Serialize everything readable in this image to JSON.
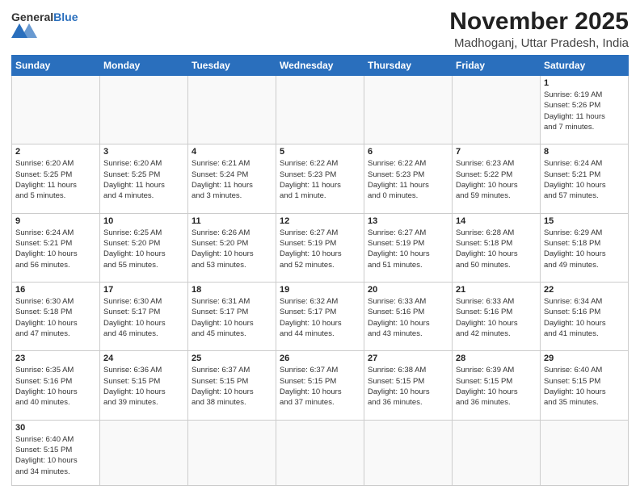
{
  "header": {
    "logo_general": "General",
    "logo_blue": "Blue",
    "month_year": "November 2025",
    "location": "Madhoganj, Uttar Pradesh, India"
  },
  "weekdays": [
    "Sunday",
    "Monday",
    "Tuesday",
    "Wednesday",
    "Thursday",
    "Friday",
    "Saturday"
  ],
  "weeks": [
    [
      {
        "day": "",
        "info": ""
      },
      {
        "day": "",
        "info": ""
      },
      {
        "day": "",
        "info": ""
      },
      {
        "day": "",
        "info": ""
      },
      {
        "day": "",
        "info": ""
      },
      {
        "day": "",
        "info": ""
      },
      {
        "day": "1",
        "info": "Sunrise: 6:19 AM\nSunset: 5:26 PM\nDaylight: 11 hours\nand 7 minutes."
      }
    ],
    [
      {
        "day": "2",
        "info": "Sunrise: 6:20 AM\nSunset: 5:25 PM\nDaylight: 11 hours\nand 5 minutes."
      },
      {
        "day": "3",
        "info": "Sunrise: 6:20 AM\nSunset: 5:25 PM\nDaylight: 11 hours\nand 4 minutes."
      },
      {
        "day": "4",
        "info": "Sunrise: 6:21 AM\nSunset: 5:24 PM\nDaylight: 11 hours\nand 3 minutes."
      },
      {
        "day": "5",
        "info": "Sunrise: 6:22 AM\nSunset: 5:23 PM\nDaylight: 11 hours\nand 1 minute."
      },
      {
        "day": "6",
        "info": "Sunrise: 6:22 AM\nSunset: 5:23 PM\nDaylight: 11 hours\nand 0 minutes."
      },
      {
        "day": "7",
        "info": "Sunrise: 6:23 AM\nSunset: 5:22 PM\nDaylight: 10 hours\nand 59 minutes."
      },
      {
        "day": "8",
        "info": "Sunrise: 6:24 AM\nSunset: 5:21 PM\nDaylight: 10 hours\nand 57 minutes."
      }
    ],
    [
      {
        "day": "9",
        "info": "Sunrise: 6:24 AM\nSunset: 5:21 PM\nDaylight: 10 hours\nand 56 minutes."
      },
      {
        "day": "10",
        "info": "Sunrise: 6:25 AM\nSunset: 5:20 PM\nDaylight: 10 hours\nand 55 minutes."
      },
      {
        "day": "11",
        "info": "Sunrise: 6:26 AM\nSunset: 5:20 PM\nDaylight: 10 hours\nand 53 minutes."
      },
      {
        "day": "12",
        "info": "Sunrise: 6:27 AM\nSunset: 5:19 PM\nDaylight: 10 hours\nand 52 minutes."
      },
      {
        "day": "13",
        "info": "Sunrise: 6:27 AM\nSunset: 5:19 PM\nDaylight: 10 hours\nand 51 minutes."
      },
      {
        "day": "14",
        "info": "Sunrise: 6:28 AM\nSunset: 5:18 PM\nDaylight: 10 hours\nand 50 minutes."
      },
      {
        "day": "15",
        "info": "Sunrise: 6:29 AM\nSunset: 5:18 PM\nDaylight: 10 hours\nand 49 minutes."
      }
    ],
    [
      {
        "day": "16",
        "info": "Sunrise: 6:30 AM\nSunset: 5:18 PM\nDaylight: 10 hours\nand 47 minutes."
      },
      {
        "day": "17",
        "info": "Sunrise: 6:30 AM\nSunset: 5:17 PM\nDaylight: 10 hours\nand 46 minutes."
      },
      {
        "day": "18",
        "info": "Sunrise: 6:31 AM\nSunset: 5:17 PM\nDaylight: 10 hours\nand 45 minutes."
      },
      {
        "day": "19",
        "info": "Sunrise: 6:32 AM\nSunset: 5:17 PM\nDaylight: 10 hours\nand 44 minutes."
      },
      {
        "day": "20",
        "info": "Sunrise: 6:33 AM\nSunset: 5:16 PM\nDaylight: 10 hours\nand 43 minutes."
      },
      {
        "day": "21",
        "info": "Sunrise: 6:33 AM\nSunset: 5:16 PM\nDaylight: 10 hours\nand 42 minutes."
      },
      {
        "day": "22",
        "info": "Sunrise: 6:34 AM\nSunset: 5:16 PM\nDaylight: 10 hours\nand 41 minutes."
      }
    ],
    [
      {
        "day": "23",
        "info": "Sunrise: 6:35 AM\nSunset: 5:16 PM\nDaylight: 10 hours\nand 40 minutes."
      },
      {
        "day": "24",
        "info": "Sunrise: 6:36 AM\nSunset: 5:15 PM\nDaylight: 10 hours\nand 39 minutes."
      },
      {
        "day": "25",
        "info": "Sunrise: 6:37 AM\nSunset: 5:15 PM\nDaylight: 10 hours\nand 38 minutes."
      },
      {
        "day": "26",
        "info": "Sunrise: 6:37 AM\nSunset: 5:15 PM\nDaylight: 10 hours\nand 37 minutes."
      },
      {
        "day": "27",
        "info": "Sunrise: 6:38 AM\nSunset: 5:15 PM\nDaylight: 10 hours\nand 36 minutes."
      },
      {
        "day": "28",
        "info": "Sunrise: 6:39 AM\nSunset: 5:15 PM\nDaylight: 10 hours\nand 36 minutes."
      },
      {
        "day": "29",
        "info": "Sunrise: 6:40 AM\nSunset: 5:15 PM\nDaylight: 10 hours\nand 35 minutes."
      }
    ],
    [
      {
        "day": "30",
        "info": "Sunrise: 6:40 AM\nSunset: 5:15 PM\nDaylight: 10 hours\nand 34 minutes."
      },
      {
        "day": "",
        "info": ""
      },
      {
        "day": "",
        "info": ""
      },
      {
        "day": "",
        "info": ""
      },
      {
        "day": "",
        "info": ""
      },
      {
        "day": "",
        "info": ""
      },
      {
        "day": "",
        "info": ""
      }
    ]
  ]
}
